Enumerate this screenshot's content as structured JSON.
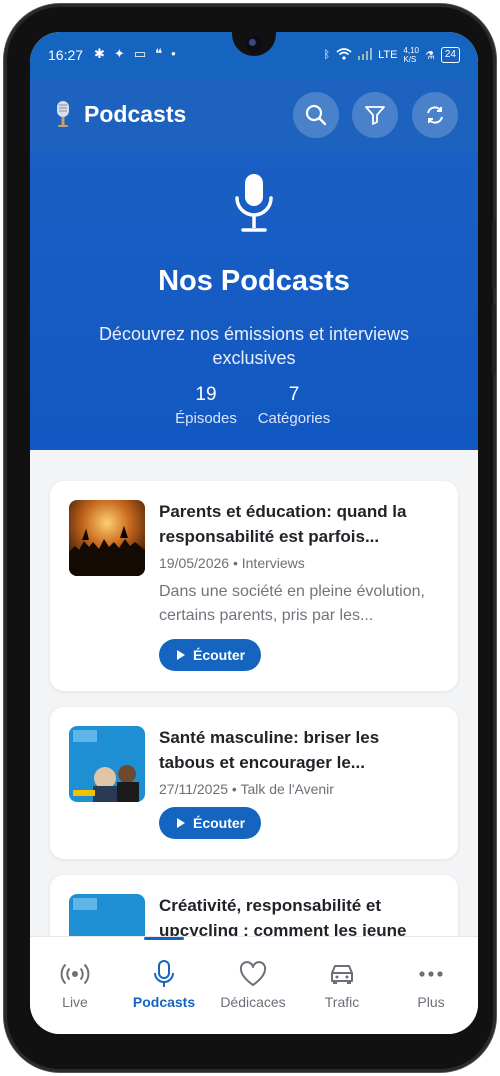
{
  "status_bar": {
    "time": "16:27",
    "left_icons": [
      "slack-icon",
      "sparkle-icon",
      "message-icon",
      "chat-bubble-icon",
      "dot-icon"
    ],
    "network": "LTE",
    "speed_value": "4,10",
    "speed_unit": "K/S",
    "battery": "24"
  },
  "app_bar": {
    "title": "Podcasts",
    "actions": [
      "search-icon",
      "filter-icon",
      "refresh-icon"
    ]
  },
  "hero": {
    "title": "Nos Podcasts",
    "description": "Découvrez nos émissions et interviews exclusives",
    "stats": [
      {
        "value": "19",
        "label": "Épisodes"
      },
      {
        "value": "7",
        "label": "Catégories"
      }
    ]
  },
  "episodes": [
    {
      "title": "Parents et éducation: quand la responsabilité est parfois...",
      "meta": "19/05/2026 • Interviews",
      "description": "Dans une société en pleine évolution, certains parents, pris par les...",
      "button": "Écouter"
    },
    {
      "title": "Santé masculine: briser les tabous et encourager le...",
      "meta": "27/11/2025 • Talk de l'Avenir",
      "button": "Écouter"
    },
    {
      "title": "Créativité, responsabilité et upcycling : comment les jeune"
    }
  ],
  "bottom_nav": [
    {
      "label": "Live",
      "icon": "broadcast-icon",
      "active": false
    },
    {
      "label": "Podcasts",
      "icon": "microphone-icon",
      "active": true
    },
    {
      "label": "Dédicaces",
      "icon": "heart-icon",
      "active": false
    },
    {
      "label": "Trafic",
      "icon": "car-icon",
      "active": false
    },
    {
      "label": "Plus",
      "icon": "more-icon",
      "active": false
    }
  ],
  "colors": {
    "primary": "#1565c0",
    "hero_bg": "#1a5fc3",
    "text_dark": "#1f2328",
    "text_muted": "#6b7078"
  }
}
